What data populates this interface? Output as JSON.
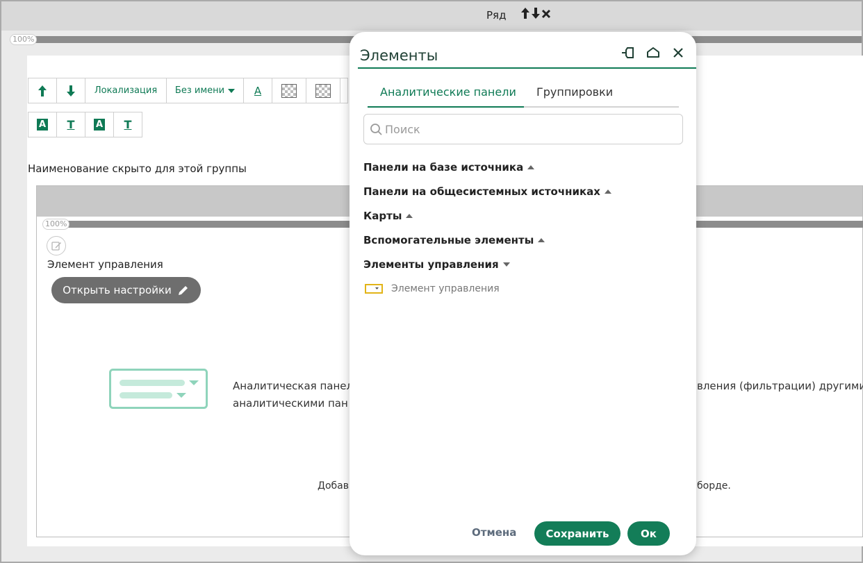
{
  "row": {
    "title": "Ряд"
  },
  "zoom": {
    "outer": "100%",
    "inner": "100%"
  },
  "toolbar": {
    "localization_label": "Локализация",
    "name_select_label": "Без имени",
    "text_color_glyph": "A",
    "fmt_a_glyph": "A",
    "fmt_t_glyph": "T"
  },
  "group": {
    "caption": "Наименование скрыто для этой группы",
    "element_title": "Элемент управления",
    "open_settings_label": "Открыть настройки",
    "desc_line1_left": "Аналитическая панел",
    "desc_line1_right": "вления (фильтрации) другими",
    "desc_line2_left": "аналитическими пан",
    "add_hint_left": "Добав",
    "add_hint_right": "борде."
  },
  "dialog": {
    "title": "Элементы",
    "tabs": [
      {
        "label": "Аналитические панели",
        "active": true
      },
      {
        "label": "Группировки",
        "active": false
      }
    ],
    "search_placeholder": "Поиск",
    "categories": [
      {
        "label": "Панели на базе источника",
        "expanded": false
      },
      {
        "label": "Панели на общесистемных источниках",
        "expanded": false
      },
      {
        "label": "Карты",
        "expanded": false
      },
      {
        "label": "Вспомогательные элементы",
        "expanded": false
      },
      {
        "label": "Элементы управления",
        "expanded": true
      }
    ],
    "sub_item": "Элемент управления",
    "cancel_label": "Отмена",
    "save_label": "Сохранить",
    "ok_label": "Ок"
  },
  "colors": {
    "accent": "#0f7a55",
    "button_green": "#137d58",
    "gray_button": "#6e6e6e",
    "control_icon": "#e2b417",
    "illustration": "#8fd4bb"
  },
  "icons": [
    "arrow-up-icon",
    "arrow-down-icon",
    "close-icon",
    "pin-icon",
    "home-icon",
    "search-icon",
    "edit-icon",
    "pencil-icon",
    "dropdown-control-icon"
  ]
}
